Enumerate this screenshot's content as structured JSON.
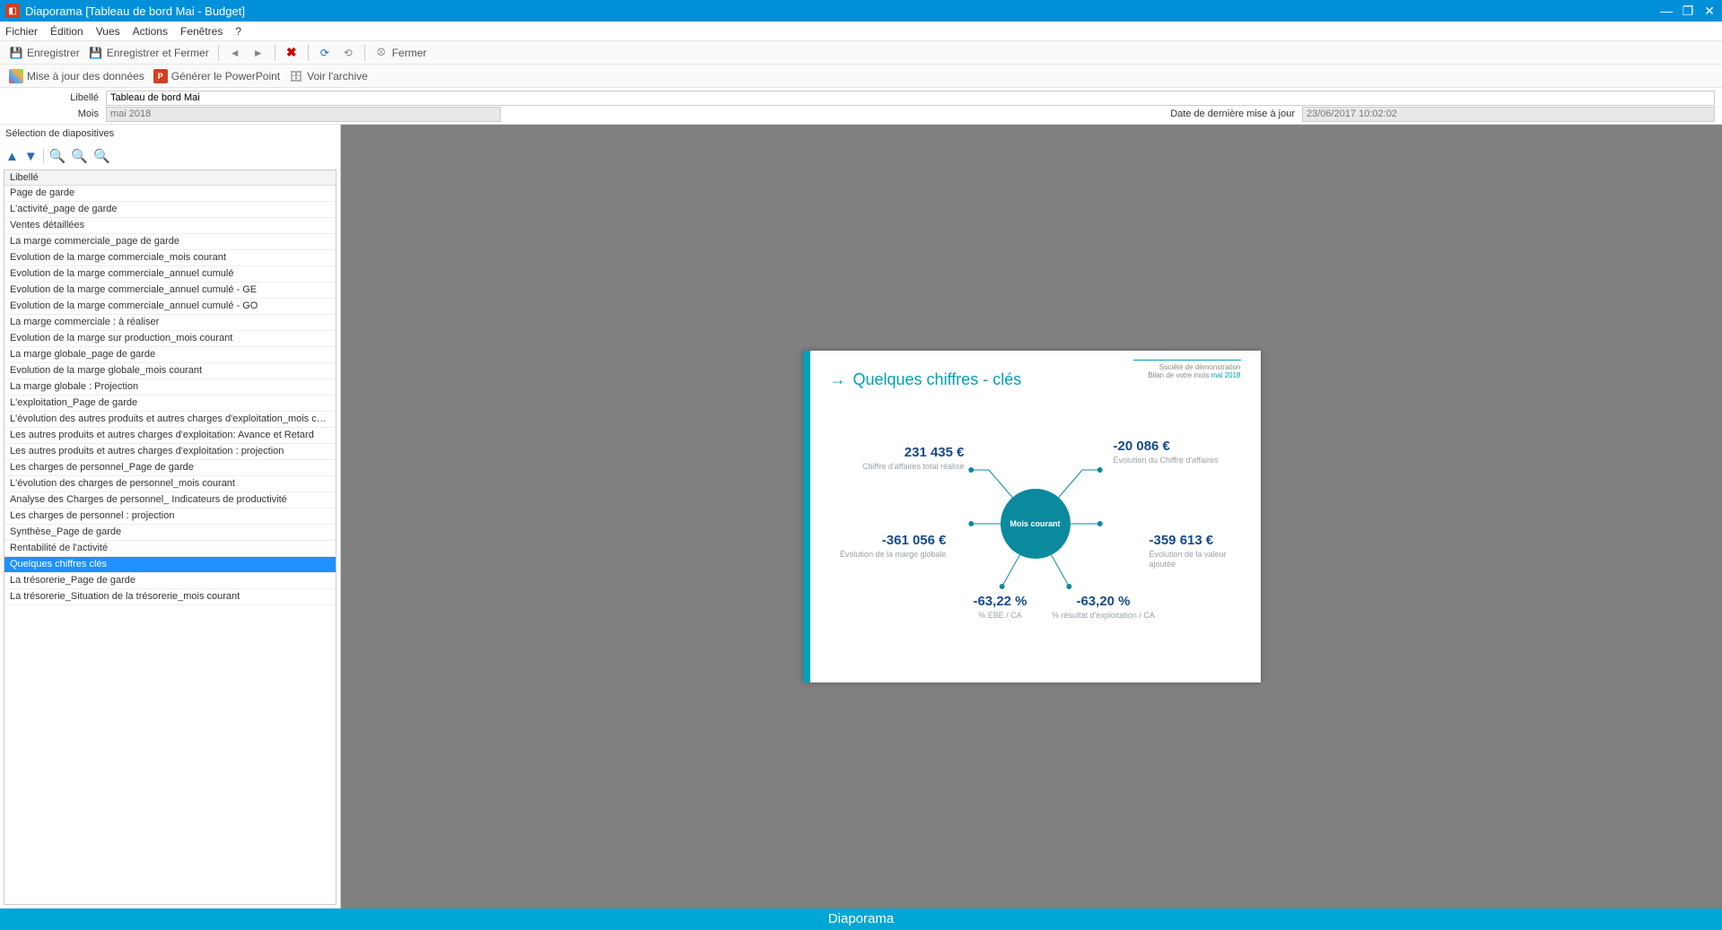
{
  "window": {
    "title": "Diaporama [Tableau de bord Mai - Budget]"
  },
  "menubar": {
    "fichier": "Fichier",
    "edition": "Édition",
    "vues": "Vues",
    "actions": "Actions",
    "fenetres": "Fenêtres",
    "help": "?"
  },
  "toolbar1": {
    "save": "Enregistrer",
    "saveclose": "Enregistrer et Fermer",
    "close": "Fermer"
  },
  "toolbar2": {
    "update": "Mise à jour des données",
    "genppt": "Générer le PowerPoint",
    "archive": "Voir l'archive"
  },
  "form": {
    "libelle_label": "Libellé",
    "libelle_value": "Tableau de bord Mai",
    "mois_label": "Mois",
    "mois_value": "mai 2018",
    "lastupdate_label": "Date de dernière mise à jour",
    "lastupdate_value": "23/06/2017 10:02:02"
  },
  "sidebar": {
    "section_label": "Sélection de diapositives",
    "col_header": "Libellé",
    "slides": [
      "Page de garde",
      "L'activité_page de garde",
      "Ventes détaillées",
      "La marge commerciale_page de garde",
      "Evolution de la marge commerciale_mois courant",
      "Evolution de la marge commerciale_annuel cumulé",
      "Evolution de la marge commerciale_annuel cumulé - GE",
      "Evolution de la marge commerciale_annuel cumulé - GO",
      "La marge commerciale : à réaliser",
      "Evolution de la marge sur production_mois courant",
      "La marge globale_page de garde",
      "Evolution de la marge globale_mois courant",
      "La marge globale : Projection",
      "L'exploitation_Page de garde",
      "L'évolution des autres produits et  autres charges d'exploitation_mois courant",
      "Les autres produits et autres charges d'exploitation: Avance et Retard",
      "Les autres produits et autres charges d'exploitation : projection",
      "Les charges de personnel_Page de garde",
      "L'évolution des charges de personnel_mois courant",
      "Analyse des Charges de personnel_ Indicateurs de productivité",
      "Les charges de personnel : projection",
      "Synthèse_Page de garde",
      "Rentabilité de l'activité",
      "Quelques chiffres clés",
      "La trésorerie_Page de garde",
      "La trésorerie_Situation de la trésorerie_mois courant"
    ],
    "selected_index": 23
  },
  "preview": {
    "company": "Société de démonstration",
    "subtitle_prefix": "Bilan de votre mois ",
    "subtitle_month": "mai 2018",
    "title": "Quelques chiffres - clés",
    "hub": "Mois courant",
    "kpis": {
      "tl": {
        "value": "231 435 €",
        "desc": "Chiffre d'affaires total réalisé"
      },
      "tr": {
        "value": "-20 086 €",
        "desc": "Évolution du Chiffre d'affaires"
      },
      "ml": {
        "value": "-361 056 €",
        "desc": "Évolution de la marge globale"
      },
      "mr": {
        "value": "-359 613 €",
        "desc": "Évolution de la valeur ajoutée"
      },
      "bl": {
        "value": "-63,22 %",
        "desc": "% EBE / CA"
      },
      "br": {
        "value": "-63,20 %",
        "desc": "% résultat d'exploitation / CA"
      }
    }
  },
  "statusbar": {
    "text": "Diaporama"
  },
  "chart_data": {
    "type": "table",
    "title": "Quelques chiffres - clés",
    "context": "Mois courant",
    "series": [
      {
        "name": "Chiffre d'affaires total réalisé",
        "value": 231435,
        "unit": "€"
      },
      {
        "name": "Évolution du Chiffre d'affaires",
        "value": -20086,
        "unit": "€"
      },
      {
        "name": "Évolution de la marge globale",
        "value": -361056,
        "unit": "€"
      },
      {
        "name": "Évolution de la valeur ajoutée",
        "value": -359613,
        "unit": "€"
      },
      {
        "name": "% EBE / CA",
        "value": -63.22,
        "unit": "%"
      },
      {
        "name": "% résultat d'exploitation / CA",
        "value": -63.2,
        "unit": "%"
      }
    ]
  }
}
